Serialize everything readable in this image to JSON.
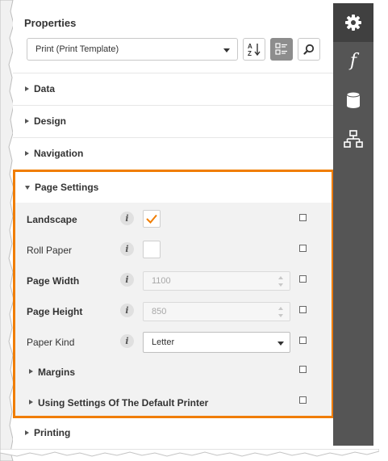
{
  "panel": {
    "title": "Properties",
    "object_selector": {
      "value": "Print (Print Template)"
    },
    "toolbar": {
      "sort_icon": "sort-az-icon",
      "categories_icon": "categories-icon",
      "search_icon": "search-icon"
    }
  },
  "sections": {
    "data": "Data",
    "design": "Design",
    "navigation": "Navigation",
    "printing": "Printing"
  },
  "page_settings": {
    "label": "Page Settings",
    "highlight_color": "#f07d00",
    "properties": {
      "landscape": {
        "label": "Landscape",
        "checked": true
      },
      "roll_paper": {
        "label": "Roll Paper",
        "checked": false
      },
      "page_width": {
        "label": "Page Width",
        "value": "1100"
      },
      "page_height": {
        "label": "Page Height",
        "value": "850"
      },
      "paper_kind": {
        "label": "Paper Kind",
        "value": "Letter"
      }
    },
    "subsections": {
      "margins": "Margins",
      "default_printer": "Using Settings Of The Default Printer"
    },
    "info_glyph": "i"
  },
  "sidebar": {
    "tabs": [
      {
        "icon": "gear-icon",
        "active": true
      },
      {
        "icon": "function-icon",
        "glyph": "f",
        "active": false
      },
      {
        "icon": "database-icon",
        "active": false
      },
      {
        "icon": "hierarchy-icon",
        "active": false
      }
    ]
  }
}
